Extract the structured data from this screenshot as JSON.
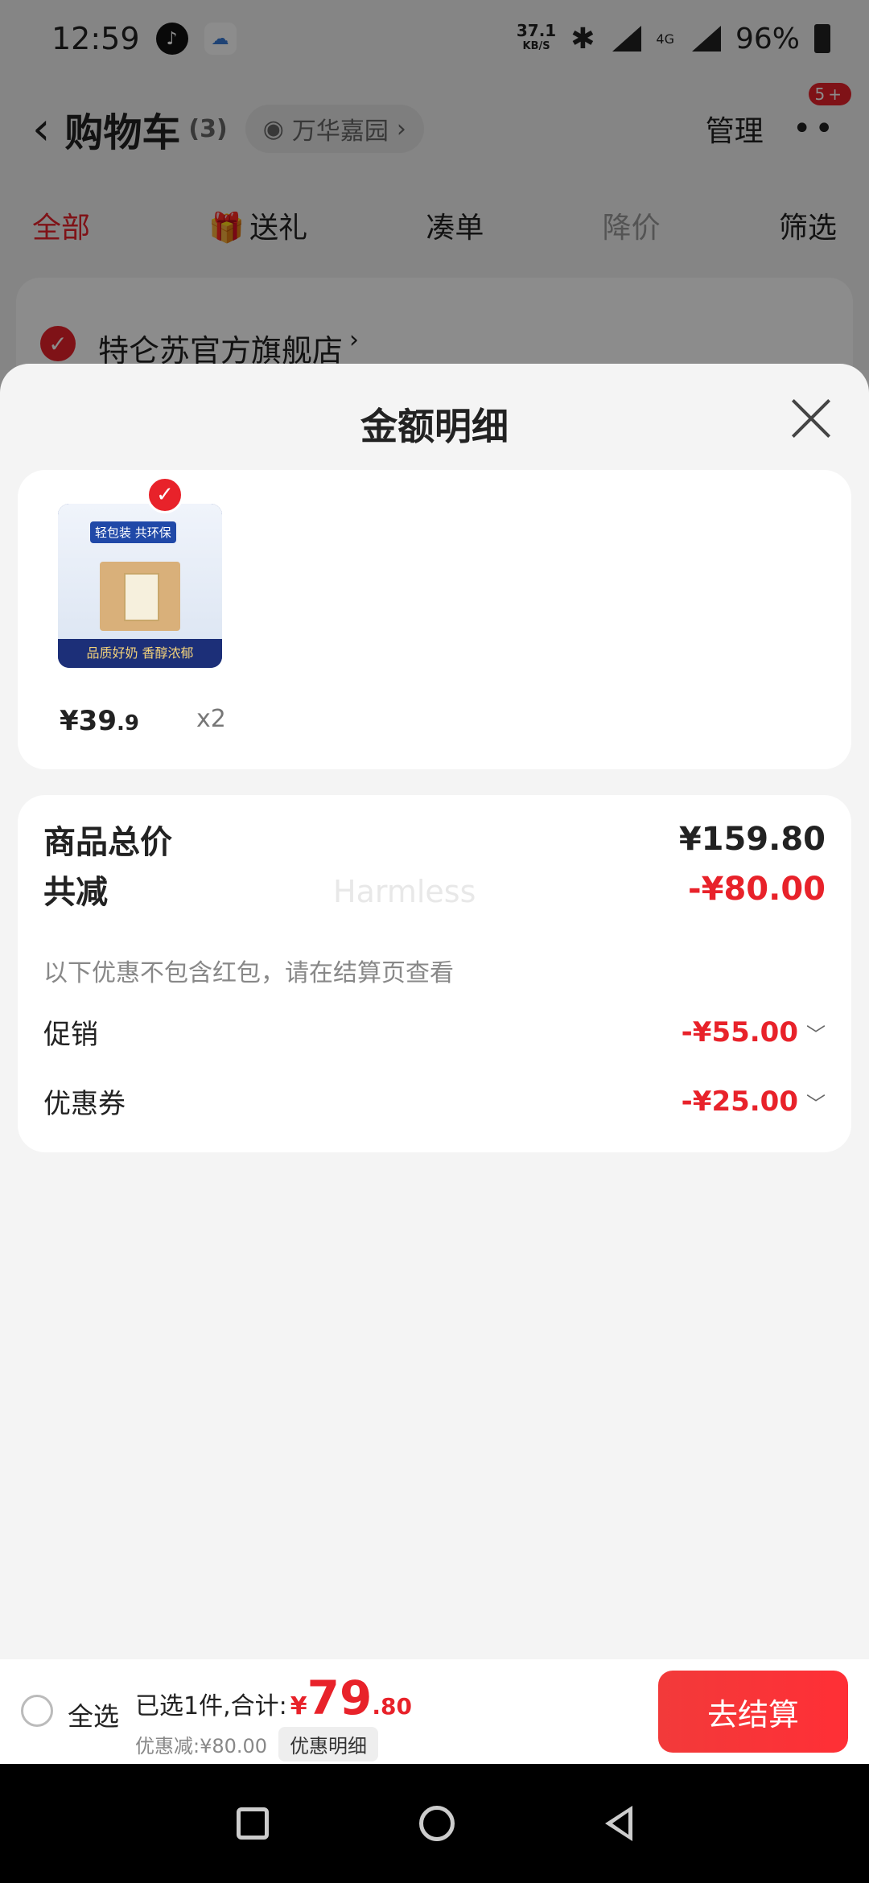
{
  "status_bar": {
    "time": "12:59",
    "speed_value": "37.1",
    "speed_unit": "KB/S",
    "network": "4G",
    "battery": "96%"
  },
  "header": {
    "title": "购物车",
    "count": "(3)",
    "address": "万华嘉园",
    "manage": "管理",
    "badge": "5+"
  },
  "tabs": [
    {
      "label": "全部"
    },
    {
      "label": "送礼"
    },
    {
      "label": "凑单"
    },
    {
      "label": "降价"
    },
    {
      "label": "筛选"
    }
  ],
  "store": {
    "name": "特仑苏官方旗舰店"
  },
  "sheet": {
    "title": "金额明细",
    "product": {
      "image_tag": "轻包装 共环保",
      "image_band": "品质好奶 香醇浓郁",
      "price_main": "¥39",
      "price_decimal": ".9",
      "quantity": "x2"
    },
    "summary": {
      "total_label": "商品总价",
      "total_value": "¥159.80",
      "discount_label": "共减",
      "discount_value": "-¥80.00",
      "note": "以下优惠不包含红包，请在结算页查看",
      "promo_label": "促销",
      "promo_value": "-¥55.00",
      "coupon_label": "优惠券",
      "coupon_value": "-¥25.00",
      "watermark": "Harmless"
    }
  },
  "bottom_bar": {
    "select_all": "全选",
    "selected_text": "已选1件,合计:",
    "currency": "¥",
    "total_int": "79",
    "total_dec": ".80",
    "discount_text": "优惠减:¥80.00",
    "detail_button": "优惠明细",
    "checkout": "去结算"
  },
  "colors": {
    "accent": "#e8222a"
  }
}
